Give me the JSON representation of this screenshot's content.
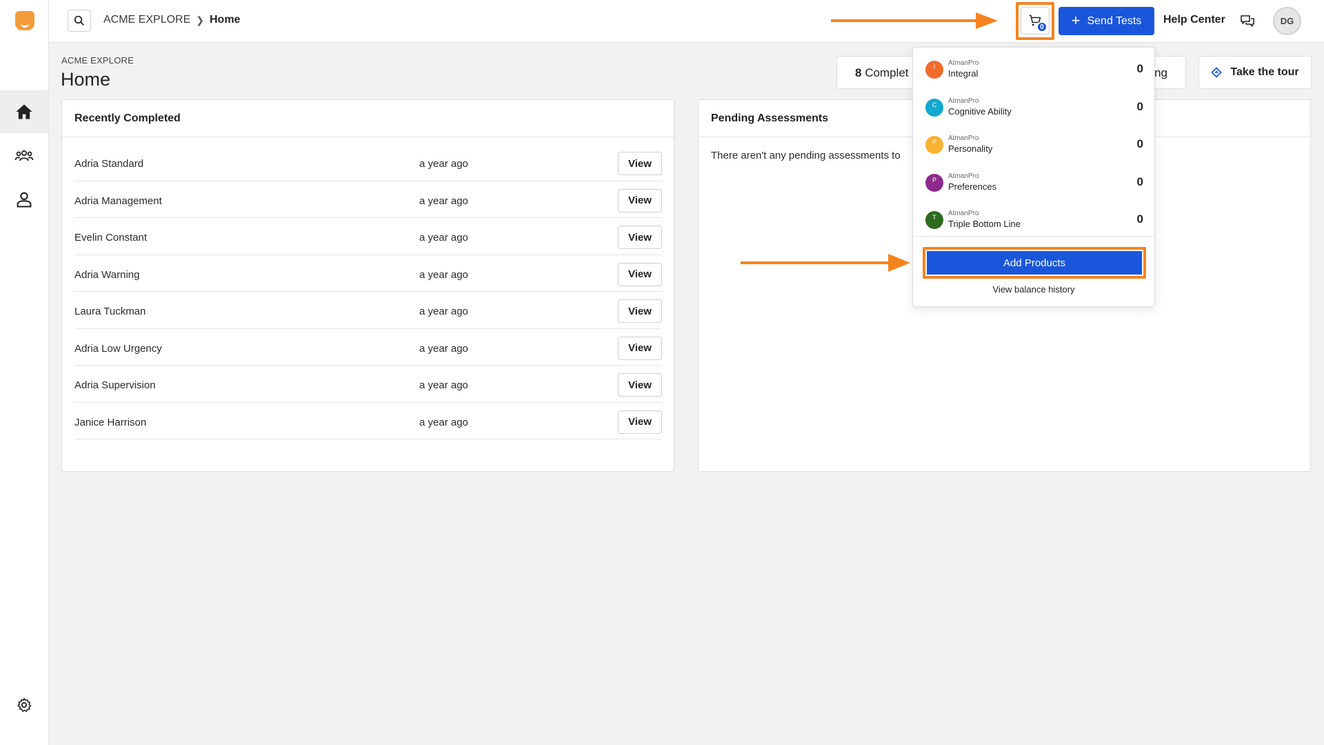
{
  "breadcrumb": {
    "org": "ACME EXPLORE",
    "current": "Home"
  },
  "topbar": {
    "cart_count": "0",
    "send_tests_label": "Send Tests",
    "help_center_label": "Help Center",
    "avatar_initials": "DG"
  },
  "page": {
    "org_label": "ACME EXPLORE",
    "title": "Home"
  },
  "stats": {
    "completed_count": "8",
    "completed_label": "Complet",
    "tail_label": "ng"
  },
  "tour": {
    "label": "Take the tour"
  },
  "recent": {
    "title": "Recently Completed",
    "view_label": "View",
    "rows": [
      {
        "name": "Adria Standard",
        "when": "a year ago"
      },
      {
        "name": "Adria Management",
        "when": "a year ago"
      },
      {
        "name": "Evelin Constant",
        "when": "a year ago"
      },
      {
        "name": "Adria Warning",
        "when": "a year ago"
      },
      {
        "name": "Laura Tuckman",
        "when": "a year ago"
      },
      {
        "name": "Adria Low Urgency",
        "when": "a year ago"
      },
      {
        "name": "Adria Supervision",
        "when": "a year ago"
      },
      {
        "name": "Janice Harrison",
        "when": "a year ago"
      }
    ]
  },
  "pending": {
    "title": "Pending Assessments",
    "empty_text": "There aren't any pending assessments to"
  },
  "dropdown": {
    "products": [
      {
        "brand": "AtmanPro",
        "name": "Integral",
        "letter": "I",
        "count": "0",
        "color": "#f26b2a"
      },
      {
        "brand": "AtmanPro",
        "name": "Cognitive Ability",
        "letter": "C",
        "count": "0",
        "color": "#12a8cf"
      },
      {
        "brand": "AtmanPro",
        "name": "Personality",
        "letter": "P",
        "count": "0",
        "color": "#f7b231"
      },
      {
        "brand": "AtmanPro",
        "name": "Preferences",
        "letter": "P",
        "count": "0",
        "color": "#8e2a8c"
      },
      {
        "brand": "AtmanPro",
        "name": "Triple Bottom Line",
        "letter": "T",
        "count": "0",
        "color": "#2e6b1f"
      }
    ],
    "add_products_label": "Add Products",
    "balance_history_label": "View balance history"
  },
  "colors": {
    "accent": "#1a56db",
    "highlight": "#f5841f",
    "logo": "#f39b3a"
  }
}
